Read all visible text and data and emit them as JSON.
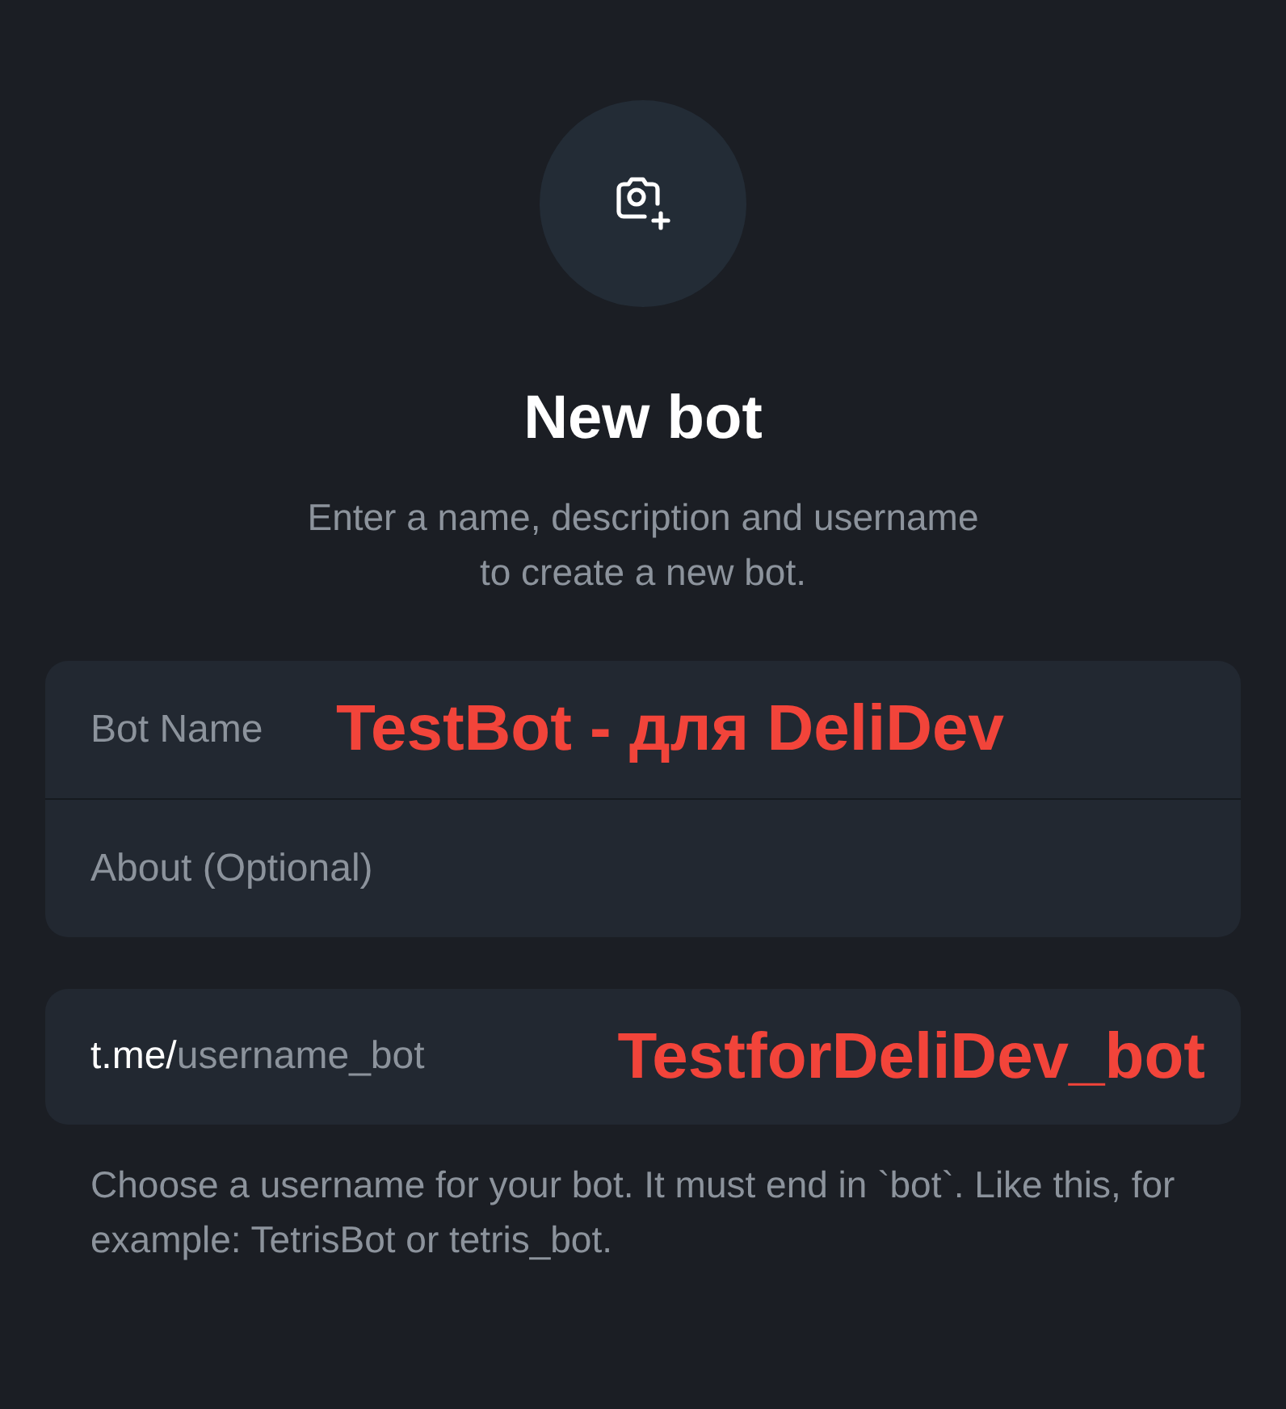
{
  "title": "New bot",
  "subtitle": "Enter a name, description and username to create a new bot.",
  "fields": [
    {
      "placeholder": "Bot Name",
      "annotation": "TestBot - для DeliDev"
    },
    {
      "placeholder": "About (Optional)"
    }
  ],
  "username": {
    "prefix": "t.me/",
    "placeholder": "username_bot",
    "annotation": "TestforDeliDev_bot"
  },
  "hint": "Choose a username for your bot. It must end in `bot`. Like this, for example: TetrisBot or tetris_bot."
}
